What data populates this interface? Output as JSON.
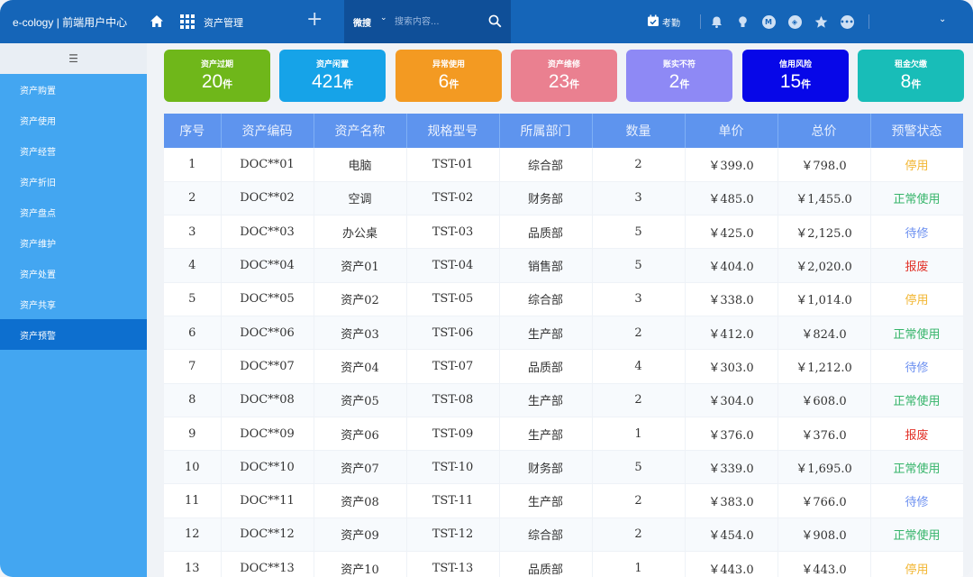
{
  "header": {
    "brand": "e-cology | 前端用户中心",
    "module": "资产管理",
    "search_scope": "微搜",
    "search_placeholder": "搜索内容...",
    "attendance": "考勤"
  },
  "icons": [
    "home-icon",
    "apps-grid-icon",
    "plus-icon",
    "search-icon",
    "calendar-check-icon",
    "bell-icon",
    "lightbulb-icon",
    "mail-icon",
    "compass-icon",
    "star-icon",
    "chat-icon",
    "chevron-down-icon",
    "menu-collapse-icon"
  ],
  "sidebar": {
    "toggle_icon": "☰",
    "items": [
      {
        "label": "资产购置"
      },
      {
        "label": "资产使用"
      },
      {
        "label": "资产经营"
      },
      {
        "label": "资产折旧"
      },
      {
        "label": "资产盘点"
      },
      {
        "label": "资产维护"
      },
      {
        "label": "资产处置"
      },
      {
        "label": "资产共享"
      },
      {
        "label": "资产预警"
      }
    ],
    "active_index": 8
  },
  "cards": [
    {
      "title": "资产过期",
      "value": "20",
      "unit": "件",
      "color": "#6fb71a"
    },
    {
      "title": "资产闲置",
      "value": "421",
      "unit": "件",
      "color": "#16a3e8"
    },
    {
      "title": "异常使用",
      "value": "6",
      "unit": "件",
      "color": "#f39a22"
    },
    {
      "title": "资产维修",
      "value": "23",
      "unit": "件",
      "color": "#ea8090"
    },
    {
      "title": "账实不符",
      "value": "2",
      "unit": "件",
      "color": "#8e89f5"
    },
    {
      "title": "信用风险",
      "value": "15",
      "unit": "件",
      "color": "#0707e8"
    },
    {
      "title": "租金欠缴",
      "value": "8",
      "unit": "件",
      "color": "#18bdb8"
    }
  ],
  "table": {
    "columns": [
      "序号",
      "资产编码",
      "资产名称",
      "规格型号",
      "所属部门",
      "数量",
      "单价",
      "总价",
      "预警状态"
    ],
    "rows": [
      [
        "1",
        "DOC**01",
        "电脑",
        "TST-01",
        "综合部",
        "2",
        "￥399.0",
        "￥798.0",
        "停用"
      ],
      [
        "2",
        "DOC**02",
        "空调",
        "TST-02",
        "财务部",
        "3",
        "￥485.0",
        "￥1,455.0",
        "正常使用"
      ],
      [
        "3",
        "DOC**03",
        "办公桌",
        "TST-03",
        "品质部",
        "5",
        "￥425.0",
        "￥2,125.0",
        "待修"
      ],
      [
        "4",
        "DOC**04",
        "资产01",
        "TST-04",
        "销售部",
        "5",
        "￥404.0",
        "￥2,020.0",
        "报废"
      ],
      [
        "5",
        "DOC**05",
        "资产02",
        "TST-05",
        "综合部",
        "3",
        "￥338.0",
        "￥1,014.0",
        "停用"
      ],
      [
        "6",
        "DOC**06",
        "资产03",
        "TST-06",
        "生产部",
        "2",
        "￥412.0",
        "￥824.0",
        "正常使用"
      ],
      [
        "7",
        "DOC**07",
        "资产04",
        "TST-07",
        "品质部",
        "4",
        "￥303.0",
        "￥1,212.0",
        "待修"
      ],
      [
        "8",
        "DOC**08",
        "资产05",
        "TST-08",
        "生产部",
        "2",
        "￥304.0",
        "￥608.0",
        "正常使用"
      ],
      [
        "9",
        "DOC**09",
        "资产06",
        "TST-09",
        "生产部",
        "1",
        "￥376.0",
        "￥376.0",
        "报废"
      ],
      [
        "10",
        "DOC**10",
        "资产07",
        "TST-10",
        "财务部",
        "5",
        "￥339.0",
        "￥1,695.0",
        "正常使用"
      ],
      [
        "11",
        "DOC**11",
        "资产08",
        "TST-11",
        "生产部",
        "2",
        "￥383.0",
        "￥766.0",
        "待修"
      ],
      [
        "12",
        "DOC**12",
        "资产09",
        "TST-12",
        "综合部",
        "2",
        "￥454.0",
        "￥908.0",
        "正常使用"
      ],
      [
        "13",
        "DOC**13",
        "资产10",
        "TST-13",
        "品质部",
        "1",
        "￥443.0",
        "￥443.0",
        "停用"
      ]
    ],
    "status_colors": {
      "停用": "#f2b632",
      "正常使用": "#35b469",
      "待修": "#6b8ff0",
      "报废": "#e2342b"
    }
  }
}
